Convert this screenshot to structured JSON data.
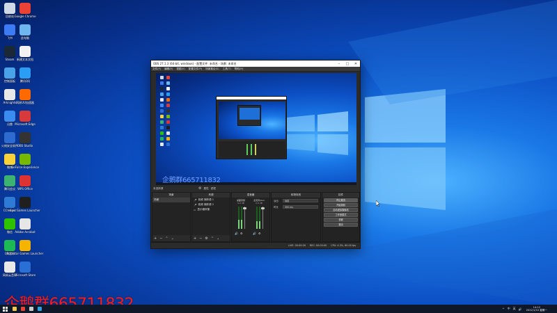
{
  "desktop": {
    "icons": [
      {
        "label": "回收站",
        "color": "#cfd8e6"
      },
      {
        "label": "Google Chrome",
        "color": "#ea4335"
      },
      {
        "label": "飞书",
        "color": "#3c7bf4"
      },
      {
        "label": "此电脑",
        "color": "#6fb6f0"
      },
      {
        "label": "Steam",
        "color": "#1b2838"
      },
      {
        "label": "新建文本文档",
        "color": "#f2f2f2"
      },
      {
        "label": "控制面板",
        "color": "#4aa3e8"
      },
      {
        "label": "腾讯QQ",
        "color": "#2a9df4"
      },
      {
        "label": "Arknights",
        "color": "#e8e8e8"
      },
      {
        "label": "网易UU加速器",
        "color": "#ff6a00"
      },
      {
        "label": "迅雷",
        "color": "#3b8cf0"
      },
      {
        "label": "Microsoft Edge",
        "color": "#d63a3a"
      },
      {
        "label": "火绒安全软件",
        "color": "#2d6bd0"
      },
      {
        "label": "OBS Studio",
        "color": "#333333"
      },
      {
        "label": "微博",
        "color": "#f7d23a"
      },
      {
        "label": "GeForce Experience",
        "color": "#76b900"
      },
      {
        "label": "腾讯会议",
        "color": "#3cb371"
      },
      {
        "label": "WPS Office",
        "color": "#d33"
      },
      {
        "label": "CCleaner",
        "color": "#2e7bd6"
      },
      {
        "label": "Epic Games Launcher",
        "color": "#1f1f1f"
      },
      {
        "label": "微信",
        "color": "#2dc100"
      },
      {
        "label": "Adobe Acrobat",
        "color": "#e6e6e6"
      },
      {
        "label": "QQ音乐",
        "color": "#1db954"
      },
      {
        "label": "Rockstar Games Launcher",
        "color": "#f5b400"
      },
      {
        "label": "网易云音乐",
        "color": "#e8e8e8"
      },
      {
        "label": "Microsoft Store",
        "color": "#2a6fd6"
      }
    ]
  },
  "obs": {
    "title": "OBS 27.1.3 (64-bit, windows) - 配置文件: 未命名 - 场景: 未命名",
    "menu": [
      "文件(F)",
      "编辑(E)",
      "视图(V)",
      "配置文件(P)",
      "场景集合(S)",
      "工具(T)",
      "帮助(H)"
    ],
    "preview_watermark": "企鹅群665711832",
    "source_bar": {
      "label": "未选择源",
      "properties": "属性",
      "filters": "滤镜"
    },
    "docks": {
      "scenes": {
        "title": "场景",
        "items": [
          "场景"
        ]
      },
      "sources": {
        "title": "来源",
        "items": [
          "音频 捕获源 1",
          "音频 捕获源 2",
          "显示器采集"
        ]
      },
      "mixer": {
        "title": "混音器",
        "channels": [
          {
            "name": "桌面音频",
            "db": "0.0 dB",
            "level": 0.42
          },
          {
            "name": "麦克风/Aux",
            "db": "0.0 dB",
            "level": 0.35
          }
        ]
      },
      "transitions": {
        "title": "转场特效",
        "rows": [
          {
            "key": "淡出",
            "value": "淡出"
          },
          {
            "key": "时长",
            "value": "300 ms"
          }
        ]
      },
      "controls": {
        "title": "控件",
        "buttons": [
          "停止推流",
          "开始录制",
          "启动虚拟摄像机",
          "工作室模式",
          "设置",
          "退出"
        ]
      }
    },
    "status": [
      "LIVE: 00:00:00",
      "REC: 00:00:00",
      "CPU: 4.3%, 60.00 fps"
    ]
  },
  "taskbar": {
    "apps": [
      {
        "name": "文件资源管理器",
        "color": "#f2c94c"
      },
      {
        "name": "Google Chrome",
        "color": "#ea4335"
      },
      {
        "name": "OBS Studio",
        "color": "#cccccc"
      },
      {
        "name": "Microsoft Edge",
        "color": "#2aa1e3"
      }
    ],
    "tray": [
      "^",
      "中",
      "英"
    ],
    "time": "14:12",
    "date": "2022/1/10 星期一"
  },
  "watermark": "企鹅群665711832",
  "colors": {
    "accent": "#0c4fc4",
    "watermark": "#ff1a1a"
  }
}
